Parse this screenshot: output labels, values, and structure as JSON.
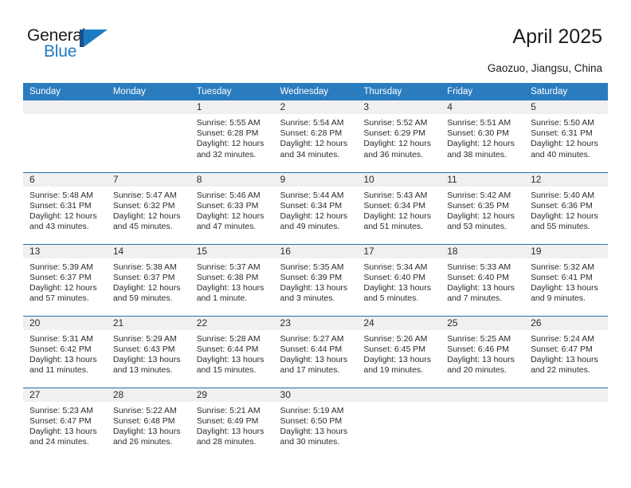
{
  "brand": {
    "name_part1": "General",
    "name_part2": "Blue",
    "logo_icon": "general-blue-triangle-logo",
    "dark_blue": "#1b4f8a",
    "blue": "#1f7bc1"
  },
  "header": {
    "title": "April 2025",
    "location": "Gaozuo, Jiangsu, China",
    "accent_color": "#2b7cbf",
    "daynum_bg": "#f0f0f0"
  },
  "weekdays": [
    "Sunday",
    "Monday",
    "Tuesday",
    "Wednesday",
    "Thursday",
    "Friday",
    "Saturday"
  ],
  "labels": {
    "sunrise_prefix": "Sunrise:",
    "sunset_prefix": "Sunset:",
    "daylight_prefix": "Daylight:"
  },
  "weeks": [
    [
      {
        "day": "",
        "empty": true
      },
      {
        "day": "",
        "empty": true
      },
      {
        "day": "1",
        "sunrise": "Sunrise: 5:55 AM",
        "sunset": "Sunset: 6:28 PM",
        "daylight_line1": "Daylight: 12 hours",
        "daylight_line2": "and 32 minutes."
      },
      {
        "day": "2",
        "sunrise": "Sunrise: 5:54 AM",
        "sunset": "Sunset: 6:28 PM",
        "daylight_line1": "Daylight: 12 hours",
        "daylight_line2": "and 34 minutes."
      },
      {
        "day": "3",
        "sunrise": "Sunrise: 5:52 AM",
        "sunset": "Sunset: 6:29 PM",
        "daylight_line1": "Daylight: 12 hours",
        "daylight_line2": "and 36 minutes."
      },
      {
        "day": "4",
        "sunrise": "Sunrise: 5:51 AM",
        "sunset": "Sunset: 6:30 PM",
        "daylight_line1": "Daylight: 12 hours",
        "daylight_line2": "and 38 minutes."
      },
      {
        "day": "5",
        "sunrise": "Sunrise: 5:50 AM",
        "sunset": "Sunset: 6:31 PM",
        "daylight_line1": "Daylight: 12 hours",
        "daylight_line2": "and 40 minutes."
      }
    ],
    [
      {
        "day": "6",
        "sunrise": "Sunrise: 5:48 AM",
        "sunset": "Sunset: 6:31 PM",
        "daylight_line1": "Daylight: 12 hours",
        "daylight_line2": "and 43 minutes."
      },
      {
        "day": "7",
        "sunrise": "Sunrise: 5:47 AM",
        "sunset": "Sunset: 6:32 PM",
        "daylight_line1": "Daylight: 12 hours",
        "daylight_line2": "and 45 minutes."
      },
      {
        "day": "8",
        "sunrise": "Sunrise: 5:46 AM",
        "sunset": "Sunset: 6:33 PM",
        "daylight_line1": "Daylight: 12 hours",
        "daylight_line2": "and 47 minutes."
      },
      {
        "day": "9",
        "sunrise": "Sunrise: 5:44 AM",
        "sunset": "Sunset: 6:34 PM",
        "daylight_line1": "Daylight: 12 hours",
        "daylight_line2": "and 49 minutes."
      },
      {
        "day": "10",
        "sunrise": "Sunrise: 5:43 AM",
        "sunset": "Sunset: 6:34 PM",
        "daylight_line1": "Daylight: 12 hours",
        "daylight_line2": "and 51 minutes."
      },
      {
        "day": "11",
        "sunrise": "Sunrise: 5:42 AM",
        "sunset": "Sunset: 6:35 PM",
        "daylight_line1": "Daylight: 12 hours",
        "daylight_line2": "and 53 minutes."
      },
      {
        "day": "12",
        "sunrise": "Sunrise: 5:40 AM",
        "sunset": "Sunset: 6:36 PM",
        "daylight_line1": "Daylight: 12 hours",
        "daylight_line2": "and 55 minutes."
      }
    ],
    [
      {
        "day": "13",
        "sunrise": "Sunrise: 5:39 AM",
        "sunset": "Sunset: 6:37 PM",
        "daylight_line1": "Daylight: 12 hours",
        "daylight_line2": "and 57 minutes."
      },
      {
        "day": "14",
        "sunrise": "Sunrise: 5:38 AM",
        "sunset": "Sunset: 6:37 PM",
        "daylight_line1": "Daylight: 12 hours",
        "daylight_line2": "and 59 minutes."
      },
      {
        "day": "15",
        "sunrise": "Sunrise: 5:37 AM",
        "sunset": "Sunset: 6:38 PM",
        "daylight_line1": "Daylight: 13 hours",
        "daylight_line2": "and 1 minute."
      },
      {
        "day": "16",
        "sunrise": "Sunrise: 5:35 AM",
        "sunset": "Sunset: 6:39 PM",
        "daylight_line1": "Daylight: 13 hours",
        "daylight_line2": "and 3 minutes."
      },
      {
        "day": "17",
        "sunrise": "Sunrise: 5:34 AM",
        "sunset": "Sunset: 6:40 PM",
        "daylight_line1": "Daylight: 13 hours",
        "daylight_line2": "and 5 minutes."
      },
      {
        "day": "18",
        "sunrise": "Sunrise: 5:33 AM",
        "sunset": "Sunset: 6:40 PM",
        "daylight_line1": "Daylight: 13 hours",
        "daylight_line2": "and 7 minutes."
      },
      {
        "day": "19",
        "sunrise": "Sunrise: 5:32 AM",
        "sunset": "Sunset: 6:41 PM",
        "daylight_line1": "Daylight: 13 hours",
        "daylight_line2": "and 9 minutes."
      }
    ],
    [
      {
        "day": "20",
        "sunrise": "Sunrise: 5:31 AM",
        "sunset": "Sunset: 6:42 PM",
        "daylight_line1": "Daylight: 13 hours",
        "daylight_line2": "and 11 minutes."
      },
      {
        "day": "21",
        "sunrise": "Sunrise: 5:29 AM",
        "sunset": "Sunset: 6:43 PM",
        "daylight_line1": "Daylight: 13 hours",
        "daylight_line2": "and 13 minutes."
      },
      {
        "day": "22",
        "sunrise": "Sunrise: 5:28 AM",
        "sunset": "Sunset: 6:44 PM",
        "daylight_line1": "Daylight: 13 hours",
        "daylight_line2": "and 15 minutes."
      },
      {
        "day": "23",
        "sunrise": "Sunrise: 5:27 AM",
        "sunset": "Sunset: 6:44 PM",
        "daylight_line1": "Daylight: 13 hours",
        "daylight_line2": "and 17 minutes."
      },
      {
        "day": "24",
        "sunrise": "Sunrise: 5:26 AM",
        "sunset": "Sunset: 6:45 PM",
        "daylight_line1": "Daylight: 13 hours",
        "daylight_line2": "and 19 minutes."
      },
      {
        "day": "25",
        "sunrise": "Sunrise: 5:25 AM",
        "sunset": "Sunset: 6:46 PM",
        "daylight_line1": "Daylight: 13 hours",
        "daylight_line2": "and 20 minutes."
      },
      {
        "day": "26",
        "sunrise": "Sunrise: 5:24 AM",
        "sunset": "Sunset: 6:47 PM",
        "daylight_line1": "Daylight: 13 hours",
        "daylight_line2": "and 22 minutes."
      }
    ],
    [
      {
        "day": "27",
        "sunrise": "Sunrise: 5:23 AM",
        "sunset": "Sunset: 6:47 PM",
        "daylight_line1": "Daylight: 13 hours",
        "daylight_line2": "and 24 minutes."
      },
      {
        "day": "28",
        "sunrise": "Sunrise: 5:22 AM",
        "sunset": "Sunset: 6:48 PM",
        "daylight_line1": "Daylight: 13 hours",
        "daylight_line2": "and 26 minutes."
      },
      {
        "day": "29",
        "sunrise": "Sunrise: 5:21 AM",
        "sunset": "Sunset: 6:49 PM",
        "daylight_line1": "Daylight: 13 hours",
        "daylight_line2": "and 28 minutes."
      },
      {
        "day": "30",
        "sunrise": "Sunrise: 5:19 AM",
        "sunset": "Sunset: 6:50 PM",
        "daylight_line1": "Daylight: 13 hours",
        "daylight_line2": "and 30 minutes."
      },
      {
        "day": "",
        "empty": true
      },
      {
        "day": "",
        "empty": true
      },
      {
        "day": "",
        "empty": true
      }
    ]
  ]
}
